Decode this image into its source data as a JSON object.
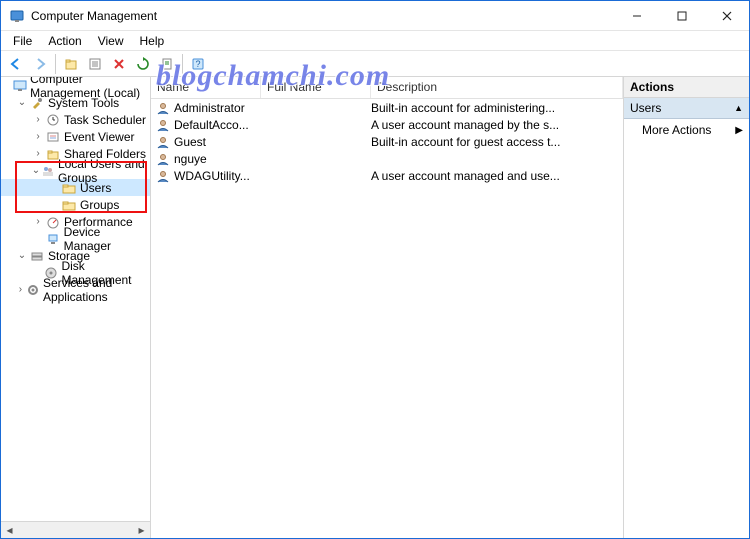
{
  "window": {
    "title": "Computer Management"
  },
  "menu": {
    "file": "File",
    "action": "Action",
    "view": "View",
    "help": "Help"
  },
  "tree": {
    "root": "Computer Management (Local)",
    "system_tools": "System Tools",
    "task_scheduler": "Task Scheduler",
    "event_viewer": "Event Viewer",
    "shared_folders": "Shared Folders",
    "local_users_groups": "Local Users and Groups",
    "users": "Users",
    "groups": "Groups",
    "performance": "Performance",
    "device_manager": "Device Manager",
    "storage": "Storage",
    "disk_management": "Disk Management",
    "services_apps": "Services and Applications"
  },
  "list": {
    "columns": {
      "name": "Name",
      "full_name": "Full Name",
      "description": "Description"
    },
    "rows": [
      {
        "name": "Administrator",
        "full": "",
        "desc": "Built-in account for administering..."
      },
      {
        "name": "DefaultAcco...",
        "full": "",
        "desc": "A user account managed by the s..."
      },
      {
        "name": "Guest",
        "full": "",
        "desc": "Built-in account for guest access t..."
      },
      {
        "name": "nguye",
        "full": "",
        "desc": ""
      },
      {
        "name": "WDAGUtility...",
        "full": "",
        "desc": "A user account managed and use..."
      }
    ]
  },
  "actions": {
    "header": "Actions",
    "scope": "Users",
    "more": "More Actions"
  },
  "watermark": "blogchamchi.com"
}
